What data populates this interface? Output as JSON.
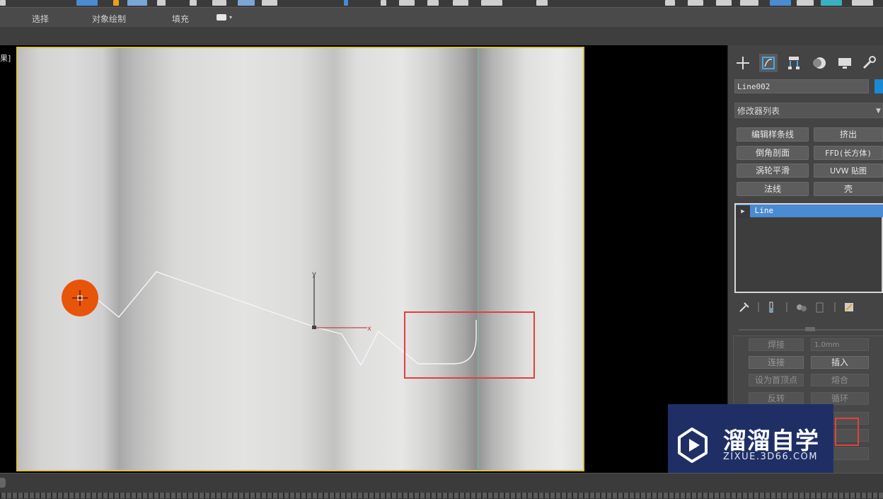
{
  "ribbon": {
    "tabs": [
      "选择",
      "对象绘制",
      "填充"
    ]
  },
  "viewport": {
    "label": "果]",
    "axis_y": "y",
    "axis_x": "x",
    "accent_frame": "#d8c04a",
    "highlight_box": "#e04040",
    "cursor_color": "#e8540a"
  },
  "panel": {
    "tabs": [
      "create-icon",
      "modify-icon",
      "hierarchy-icon",
      "motion-icon",
      "display-icon",
      "utilities-icon"
    ],
    "object_name": "Line002",
    "object_color": "#1a8ad4",
    "modifier_list": "修改器列表",
    "modifier_buttons": [
      [
        "编辑样条线",
        "挤出"
      ],
      [
        "倒角剖面",
        "FFD(长方体)"
      ],
      [
        "涡轮平滑",
        "UVW 贴图"
      ],
      [
        "法线",
        "壳"
      ]
    ],
    "stack_item": "Line"
  },
  "rollout": {
    "weld": "焊接",
    "weld_value": "1.0mm",
    "connect": "连接",
    "insert": "插入",
    "make_first": "设为首顶点",
    "fuse": "熔合",
    "reverse": "反转",
    "cycle": "循环"
  },
  "watermark": {
    "title": "溜溜自学",
    "url": "ZIXUE.3D66.COM"
  }
}
